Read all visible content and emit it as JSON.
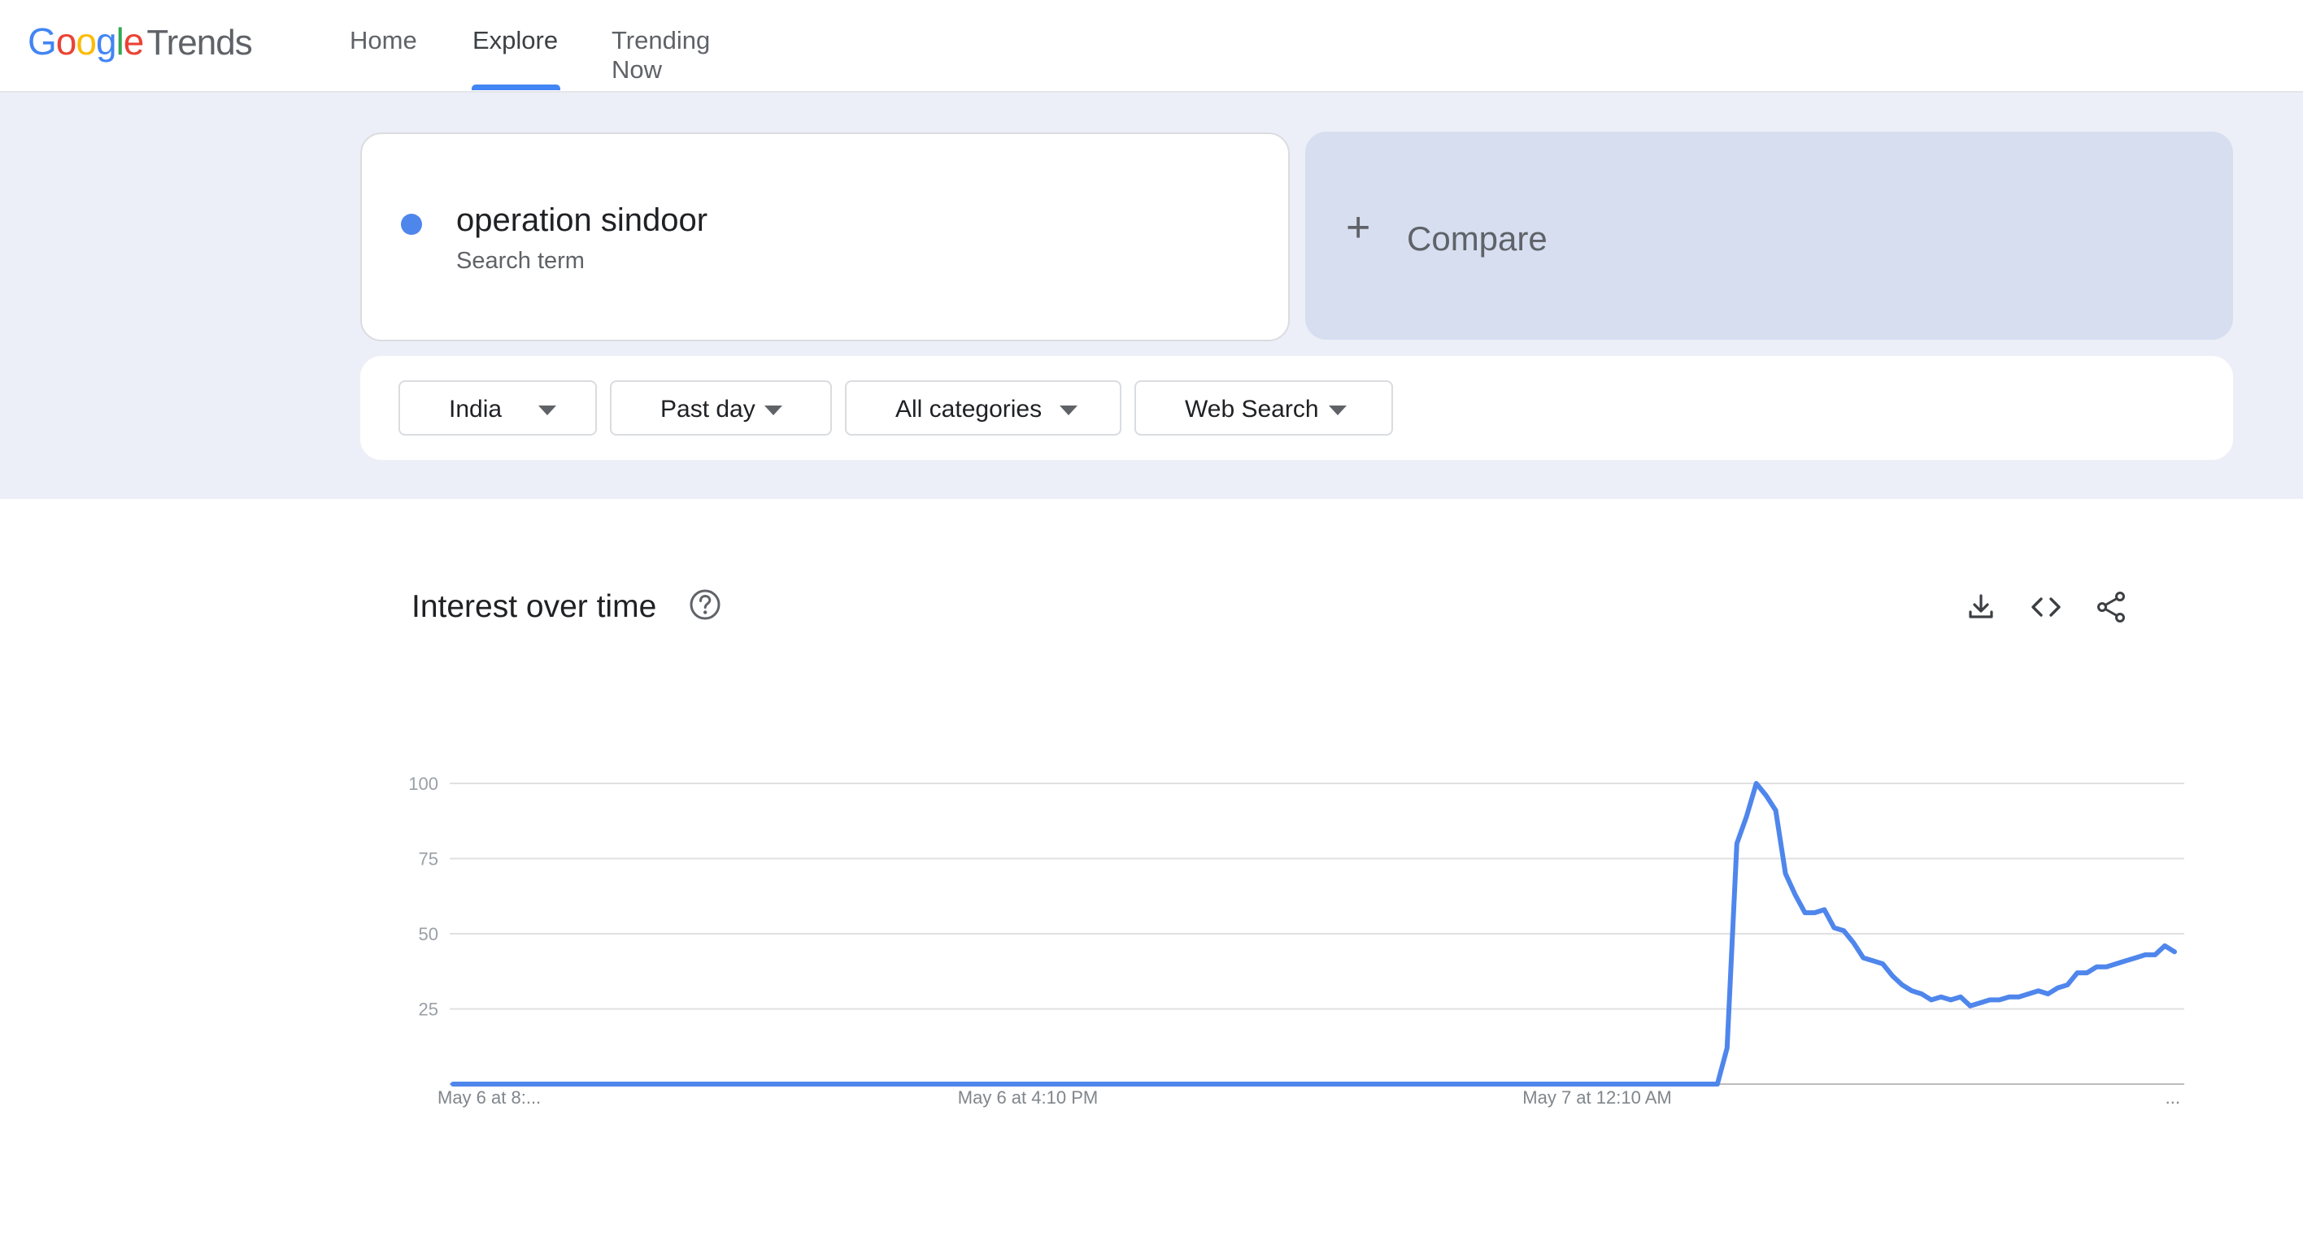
{
  "header": {
    "logo_google": "Google",
    "logo_trends": "Trends",
    "nav": [
      {
        "label": "Home",
        "active": false
      },
      {
        "label": "Explore",
        "active": true
      },
      {
        "label": "Trending Now",
        "active": false
      }
    ]
  },
  "search": {
    "term": "operation sindoor",
    "term_type": "Search term",
    "term_color": "#4f86ec",
    "compare_label": "Compare"
  },
  "filters": [
    {
      "label": "India"
    },
    {
      "label": "Past day"
    },
    {
      "label": "All categories"
    },
    {
      "label": "Web Search"
    }
  ],
  "chart_section": {
    "title": "Interest over time",
    "icons": [
      "help-icon",
      "download-icon",
      "embed-code-icon",
      "share-icon"
    ]
  },
  "chart_data": {
    "type": "line",
    "title": "Interest over time",
    "xlabel": "",
    "ylabel": "",
    "ylim": [
      0,
      100
    ],
    "yticks": [
      25,
      50,
      75,
      100
    ],
    "x_tick_labels": [
      "May 6 at 8:...",
      "May 6 at 4:10 PM",
      "May 7 at 12:10 AM",
      "..."
    ],
    "grid": true,
    "series": [
      {
        "name": "operation sindoor",
        "color": "#4f86ec",
        "values": [
          0,
          0,
          0,
          0,
          0,
          0,
          0,
          0,
          0,
          0,
          0,
          0,
          0,
          0,
          0,
          0,
          0,
          0,
          0,
          0,
          0,
          0,
          0,
          0,
          0,
          0,
          0,
          0,
          0,
          0,
          0,
          0,
          0,
          0,
          0,
          0,
          0,
          0,
          0,
          0,
          0,
          0,
          0,
          0,
          0,
          0,
          0,
          0,
          0,
          0,
          0,
          0,
          0,
          0,
          0,
          0,
          0,
          0,
          0,
          0,
          0,
          0,
          0,
          0,
          0,
          0,
          0,
          0,
          0,
          0,
          0,
          0,
          0,
          0,
          0,
          0,
          0,
          0,
          0,
          0,
          0,
          0,
          0,
          0,
          0,
          0,
          0,
          0,
          0,
          0,
          0,
          0,
          0,
          0,
          0,
          0,
          0,
          0,
          0,
          0,
          0,
          0,
          0,
          0,
          0,
          0,
          0,
          0,
          0,
          0,
          0,
          0,
          0,
          0,
          0,
          0,
          0,
          0,
          0,
          0,
          0,
          0,
          0,
          0,
          0,
          0,
          0,
          0,
          0,
          0,
          0,
          12,
          80,
          89,
          100,
          96,
          91,
          70,
          63,
          57,
          57,
          58,
          52,
          51,
          47,
          42,
          41,
          40,
          36,
          33,
          31,
          30,
          28,
          29,
          28,
          29,
          26,
          27,
          28,
          28,
          29,
          29,
          30,
          31,
          30,
          32,
          33,
          37,
          37,
          39,
          39,
          40,
          41,
          42,
          43,
          43,
          46,
          44
        ]
      }
    ]
  }
}
